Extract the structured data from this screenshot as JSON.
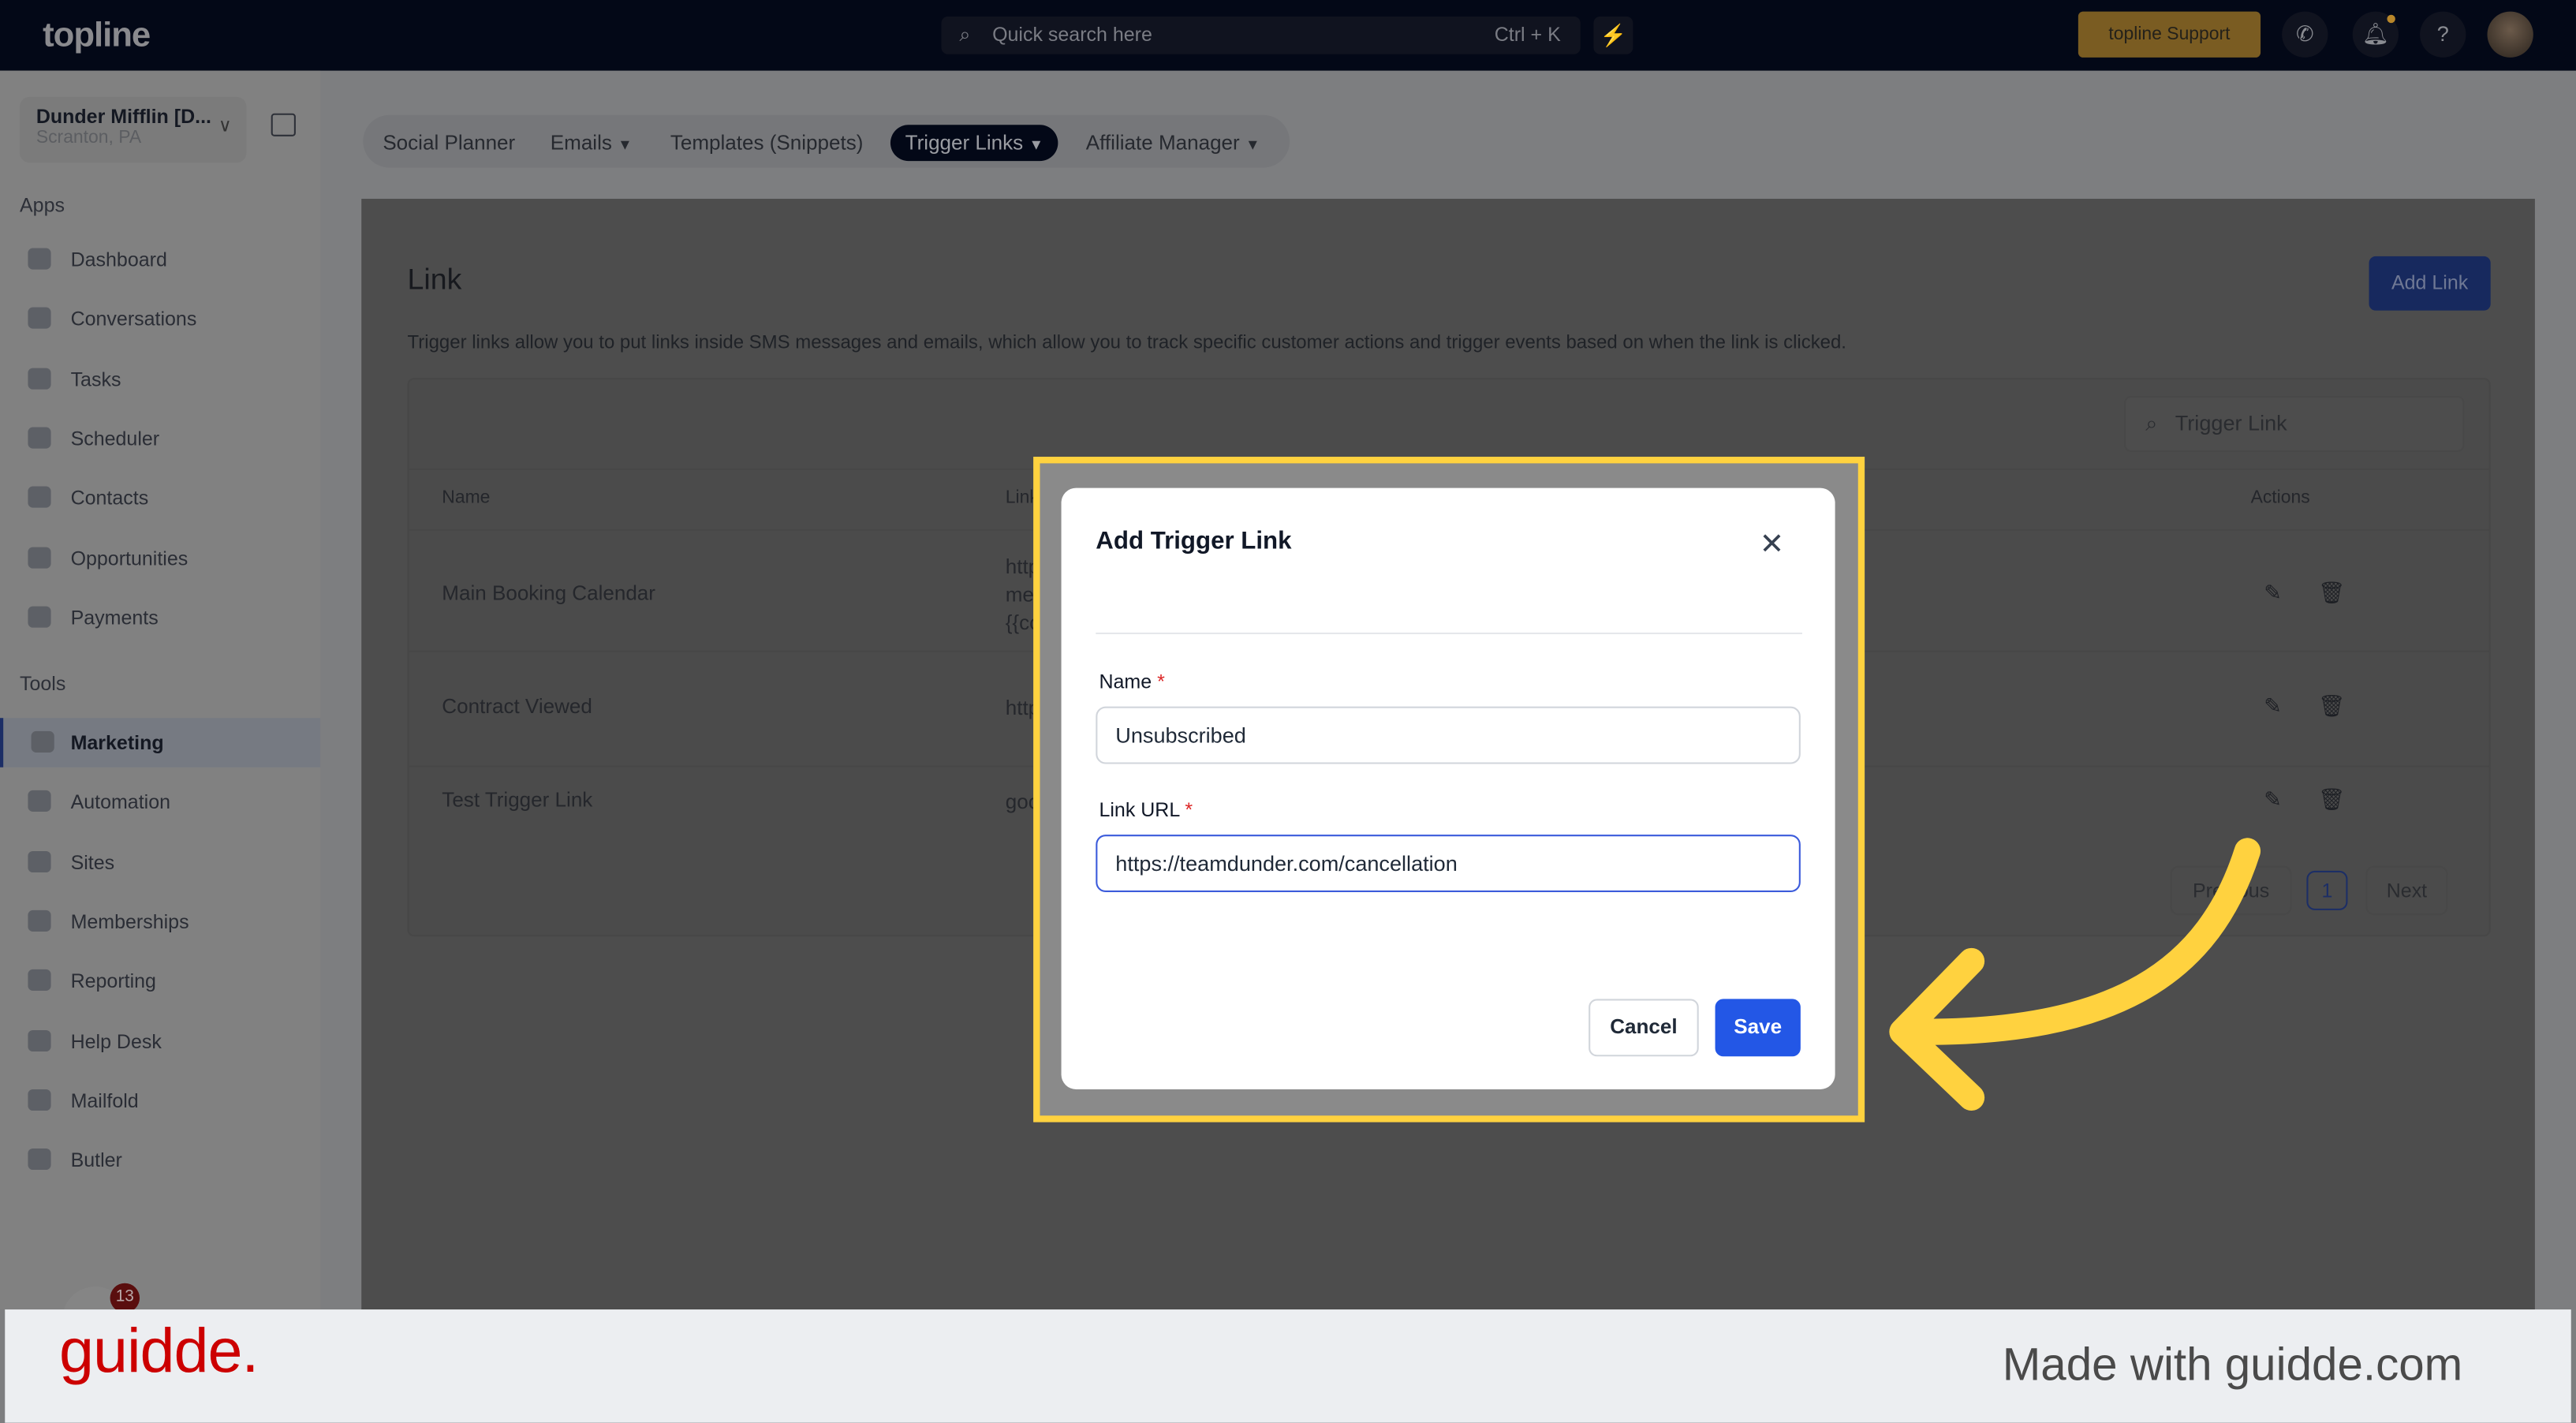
{
  "topbar": {
    "logo": "topline",
    "search_placeholder": "Quick search here",
    "search_shortcut": "Ctrl + K",
    "support_label": "topline Support",
    "icons": [
      "search-icon",
      "bolt-icon",
      "phone-icon",
      "bell-icon",
      "help-icon",
      "avatar"
    ]
  },
  "account": {
    "name": "Dunder Mifflin [D...",
    "location": "Scranton, PA"
  },
  "sidebar": {
    "apps_label": "Apps",
    "apps": [
      {
        "label": "Dashboard"
      },
      {
        "label": "Conversations"
      },
      {
        "label": "Tasks"
      },
      {
        "label": "Scheduler"
      },
      {
        "label": "Contacts"
      },
      {
        "label": "Opportunities"
      },
      {
        "label": "Payments"
      }
    ],
    "tools_label": "Tools",
    "tools": [
      {
        "label": "Marketing",
        "active": true
      },
      {
        "label": "Automation"
      },
      {
        "label": "Sites"
      },
      {
        "label": "Memberships"
      },
      {
        "label": "Reporting"
      },
      {
        "label": "Help Desk"
      },
      {
        "label": "Mailfold"
      },
      {
        "label": "Butler"
      }
    ],
    "chat_badge": "13"
  },
  "tabs": [
    {
      "label": "Social Planner"
    },
    {
      "label": "Emails",
      "dropdown": true
    },
    {
      "label": "Templates (Snippets)"
    },
    {
      "label": "Trigger Links",
      "dropdown": true,
      "active": true
    },
    {
      "label": "Affiliate Manager",
      "dropdown": true
    }
  ],
  "page": {
    "title": "Link",
    "description": "Trigger links allow you to put links inside SMS messages and emails, which allow you to track specific customer actions and trigger events based on when the link is clicked.",
    "add_button": "Add Link",
    "search_placeholder": "Trigger Link"
  },
  "table": {
    "columns": [
      "Name",
      "Link URL",
      "Actions"
    ],
    "rows": [
      {
        "name": "Main Booking Calendar",
        "url_lines": [
          "https:/",
          "me={{",
          "{{cont"
        ]
      },
      {
        "name": "Contract Viewed",
        "url_lines": [
          "https:/"
        ]
      },
      {
        "name": "Test Trigger Link",
        "url_lines": [
          "googl"
        ]
      }
    ],
    "pagination": {
      "previous": "Previous",
      "current": "1",
      "next": "Next"
    }
  },
  "dialog": {
    "title": "Add Trigger Link",
    "name_label": "Name",
    "name_value": "Unsubscribed",
    "url_label": "Link URL",
    "url_value": "https://teamdunder.com/cancellation",
    "required_mark": "*",
    "cancel": "Cancel",
    "save": "Save"
  },
  "footer": {
    "logo": "guidde.",
    "tagline": "Made with guidde.com"
  },
  "colors": {
    "highlight": "#ffd23f",
    "save": "#2357e6",
    "guidde_red": "#cc0000"
  }
}
